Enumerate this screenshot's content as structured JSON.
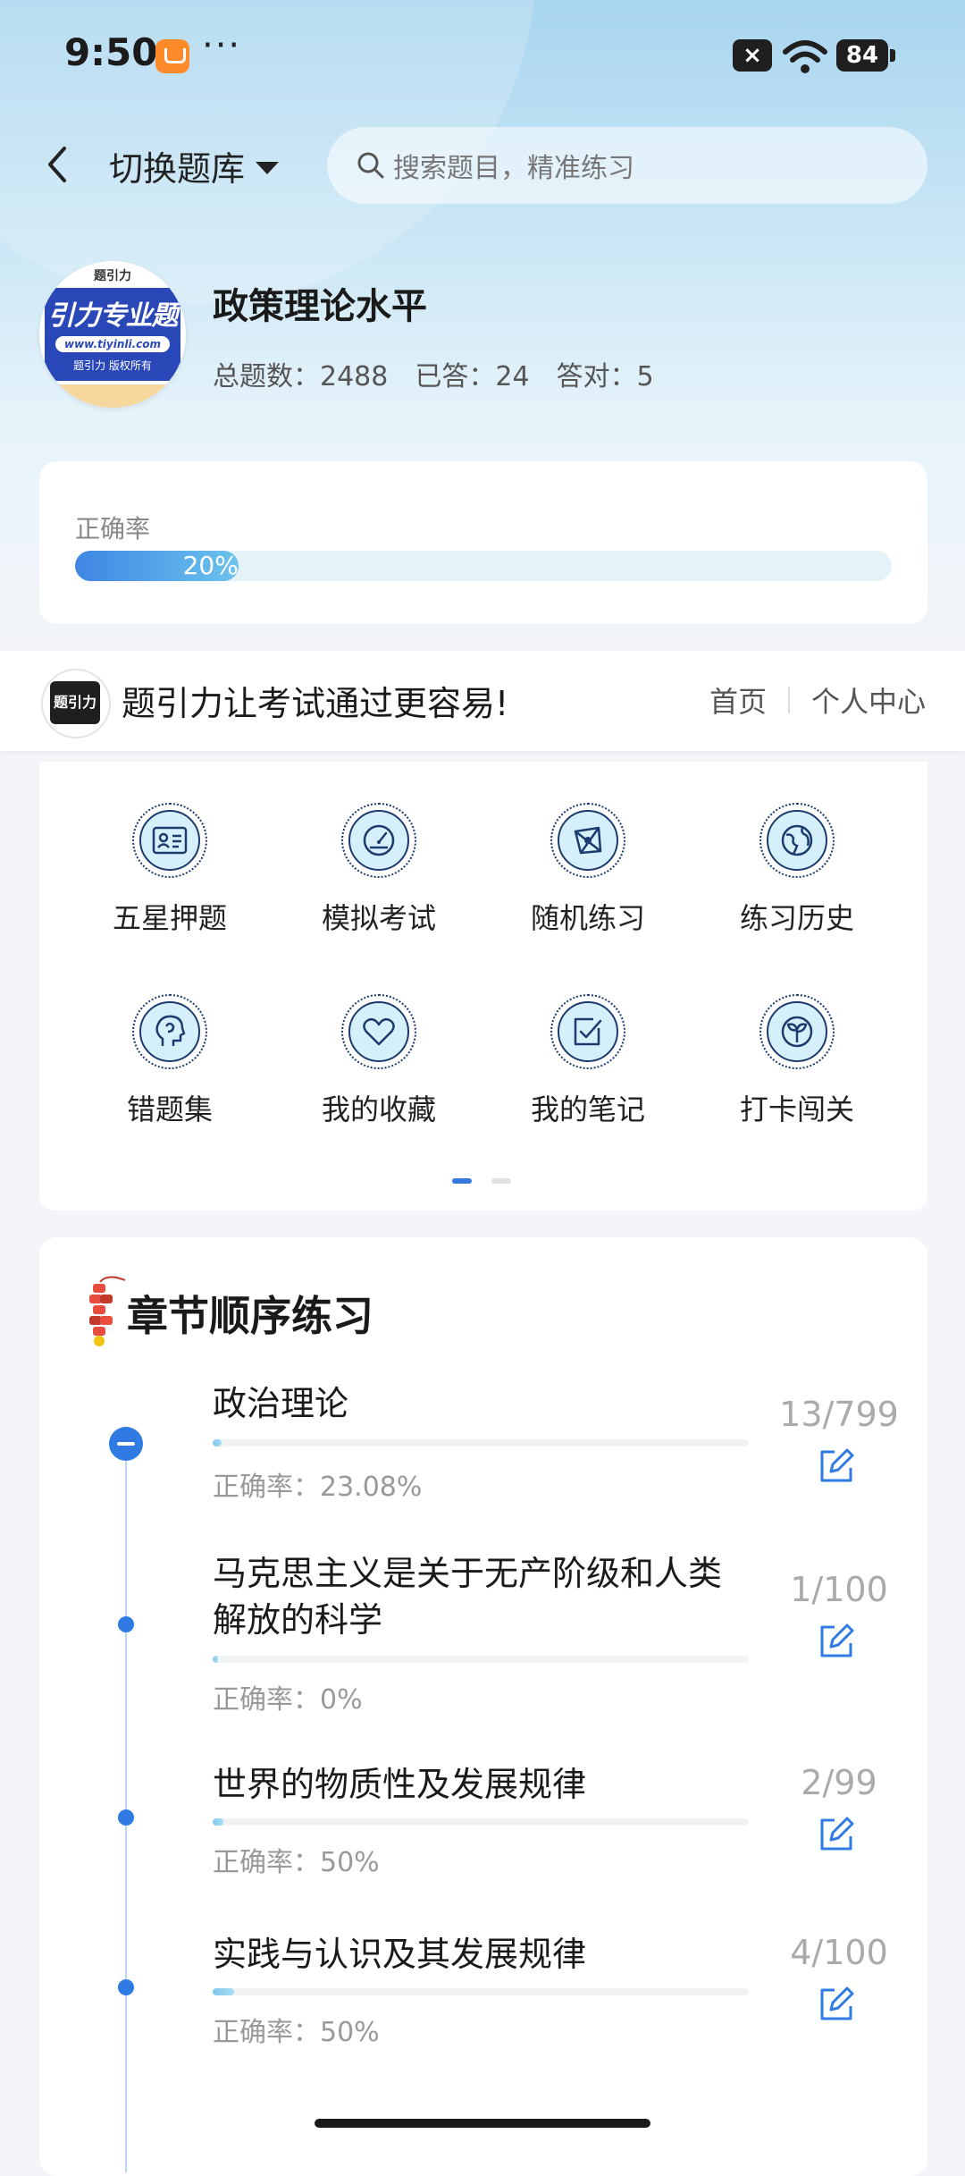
{
  "status_bar": {
    "time": "9:50",
    "more": "···",
    "battery": "84"
  },
  "header": {
    "switch_bank_label": "切换题库",
    "search_placeholder": "搜索题目，精准练习"
  },
  "bank": {
    "logo": {
      "top_mark": "题引力",
      "big_text": "引力专业题",
      "url": "www.tiyinli.com",
      "copyright": "题引力 版权所有"
    },
    "title": "政策理论水平",
    "stats": [
      {
        "label": "总题数：",
        "value": "2488"
      },
      {
        "label": "已答：",
        "value": "24"
      },
      {
        "label": "答对：",
        "value": "5"
      }
    ]
  },
  "accuracy": {
    "label": "正确率",
    "value_text": "20%",
    "fraction": 0.2
  },
  "banner": {
    "brand_glyph": "题引力",
    "slogan": "题引力让考试通过更容易!",
    "nav": [
      "首页",
      "个人中心"
    ]
  },
  "grid": {
    "items": [
      {
        "label": "五星押题",
        "icon": "id-card-icon"
      },
      {
        "label": "模拟考试",
        "icon": "speedometer-icon"
      },
      {
        "label": "随机练习",
        "icon": "network-icon"
      },
      {
        "label": "练习历史",
        "icon": "globe-icon"
      },
      {
        "label": "错题集",
        "icon": "head-icon"
      },
      {
        "label": "我的收藏",
        "icon": "heart-icon"
      },
      {
        "label": "我的笔记",
        "icon": "checkbox-icon"
      },
      {
        "label": "打卡闯关",
        "icon": "leaf-icon"
      }
    ],
    "pager": {
      "current": 1,
      "total": 2
    }
  },
  "chapters": {
    "title": "章节顺序练习",
    "items": [
      {
        "name": "政治理论",
        "accuracy": "正确率：23.08%",
        "count": "13/799",
        "progress": 0.016
      },
      {
        "name": "马克思主义是关于无产阶级和人类解放的科学",
        "accuracy": "正确率：0%",
        "count": "1/100",
        "progress": 0.01
      },
      {
        "name": "世界的物质性及发展规律",
        "accuracy": "正确率：50%",
        "count": "2/99",
        "progress": 0.02
      },
      {
        "name": "实践与认识及其发展规律",
        "accuracy": "正确率：50%",
        "count": "4/100",
        "progress": 0.04
      }
    ]
  }
}
